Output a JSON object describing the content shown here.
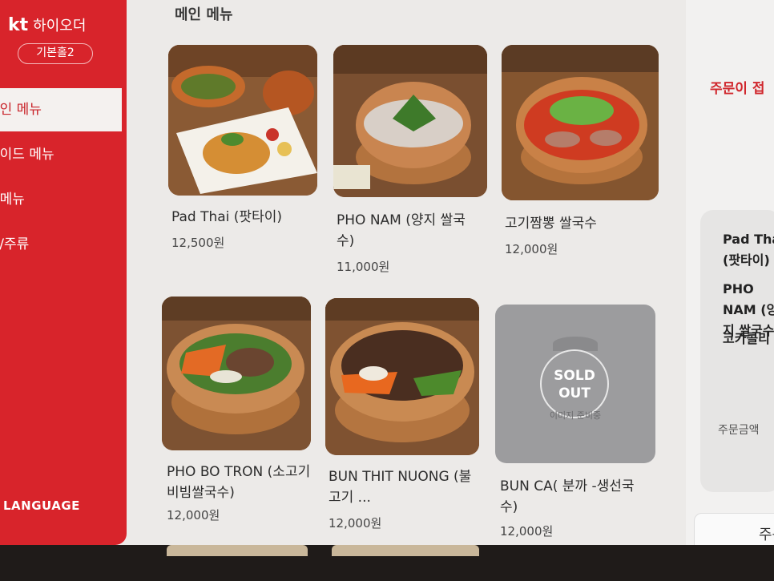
{
  "brand": {
    "logo": "kt",
    "app_name": "하이오더",
    "store": "기본홀2"
  },
  "sidebar": {
    "items": [
      {
        "label": "메인 메뉴",
        "active": true
      },
      {
        "label": "사이드 메뉴",
        "active": false
      },
      {
        "label": "주메뉴",
        "active": false
      },
      {
        "label": "음료/주류",
        "active": false
      }
    ],
    "language": "LANGUAGE"
  },
  "section": {
    "title": "메인 메뉴"
  },
  "menu": [
    {
      "name": "Pad Thai (팟타이)",
      "price": "12,500원",
      "sold_out": false
    },
    {
      "name": "PHO NAM (양지 쌀국수)",
      "price": "11,000원",
      "sold_out": false
    },
    {
      "name": "고기짬뽕 쌀국수",
      "price": "12,000원",
      "sold_out": false
    },
    {
      "name": "PHO BO TRON (소고기 비빔쌀국수)",
      "price": "12,000원",
      "sold_out": false
    },
    {
      "name": "BUN THIT NUONG (불고기 ...",
      "price": "12,000원",
      "sold_out": false
    },
    {
      "name": "BUN CA( 분까 -생선국수)",
      "price": "12,000원",
      "sold_out": true
    }
  ],
  "soldout": {
    "badge": "SOLD OUT",
    "placeholder": "이미지 준비중"
  },
  "cart": {
    "status": "주문이 접",
    "items": [
      "Pad Thai (팟타이)",
      "PHO NAM (양지 쌀국수)",
      "코카콜리"
    ],
    "total_label": "주문금액",
    "order_button": "주문"
  },
  "colors": {
    "accent": "#d8242b",
    "background": "#eceae8"
  }
}
